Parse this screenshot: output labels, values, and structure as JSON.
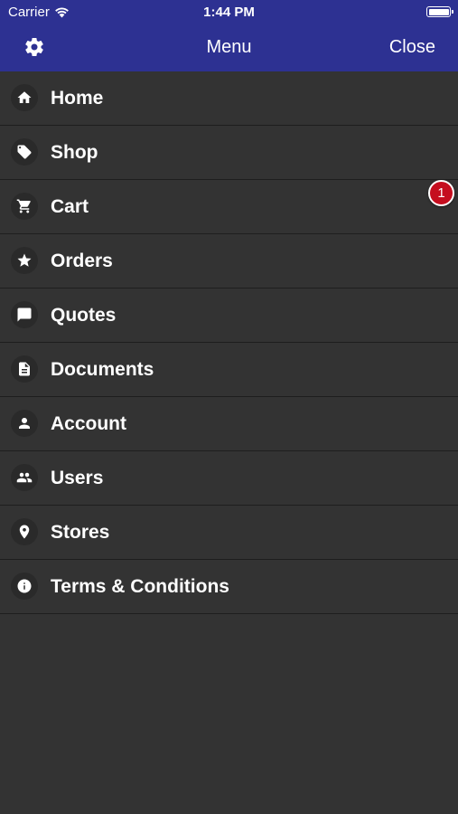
{
  "status_bar": {
    "carrier": "Carrier",
    "time": "1:44 PM"
  },
  "nav": {
    "title": "Menu",
    "close_label": "Close",
    "settings_icon": "gear-icon"
  },
  "menu": {
    "items": [
      {
        "label": "Home",
        "icon": "home-icon"
      },
      {
        "label": "Shop",
        "icon": "tag-icon"
      },
      {
        "label": "Cart",
        "icon": "cart-icon",
        "badge": "1"
      },
      {
        "label": "Orders",
        "icon": "star-icon"
      },
      {
        "label": "Quotes",
        "icon": "chat-bubble-icon"
      },
      {
        "label": "Documents",
        "icon": "document-icon"
      },
      {
        "label": "Account",
        "icon": "person-icon"
      },
      {
        "label": "Users",
        "icon": "people-icon"
      },
      {
        "label": "Stores",
        "icon": "location-pin-icon"
      },
      {
        "label": "Terms & Conditions",
        "icon": "info-icon"
      }
    ]
  },
  "colors": {
    "header_bg": "#2d3192",
    "menu_bg": "#333333",
    "badge_bg": "#c50e1f",
    "text": "#ffffff"
  }
}
